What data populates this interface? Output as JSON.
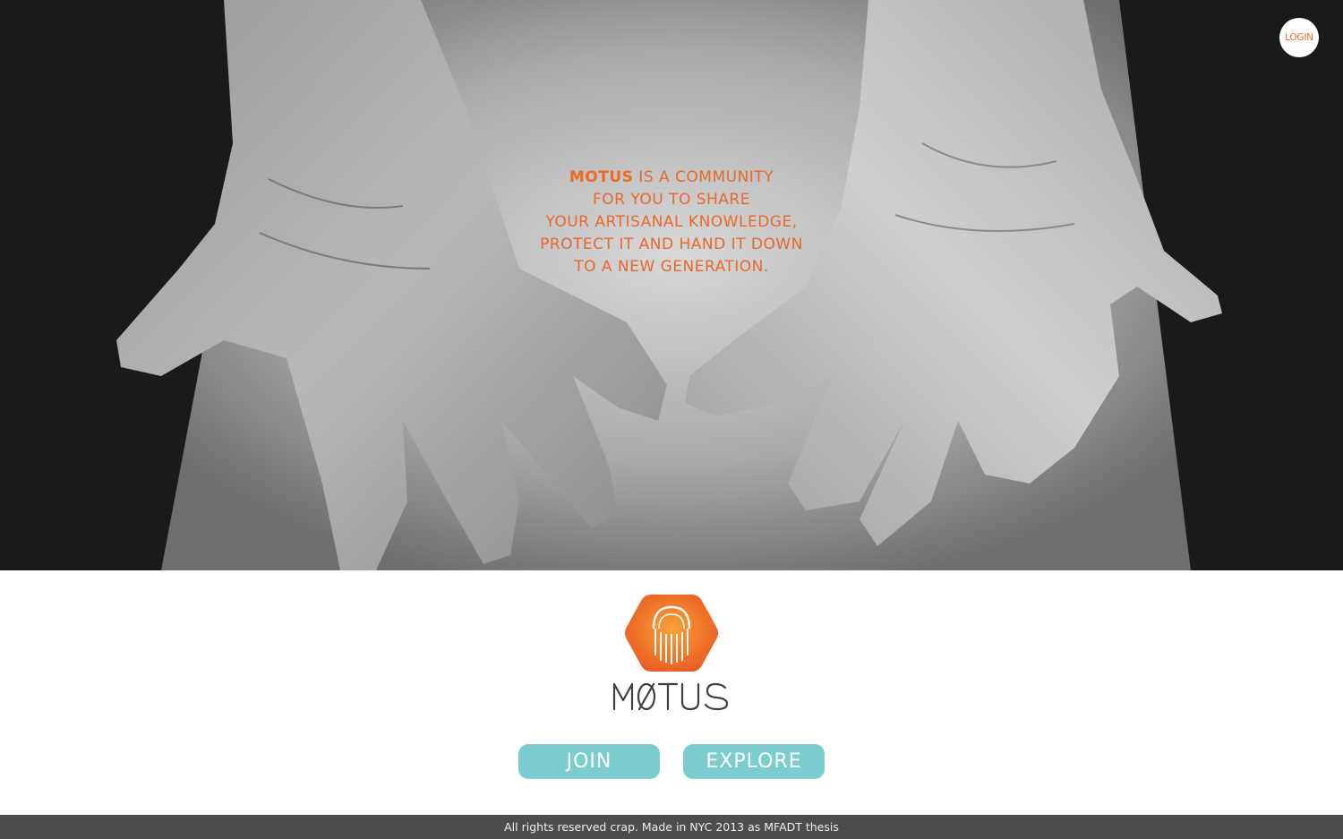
{
  "hero": {
    "tagline_brand": "MOTUS",
    "tagline_line1_rest": " IS A COMMUNITY",
    "tagline_line2": "FOR YOU TO SHARE",
    "tagline_line3": "YOUR ARTISANAL KNOWLEDGE,",
    "tagline_line4": "PROTECT IT AND HAND IT DOWN",
    "tagline_line5": "TO A NEW GENERATION."
  },
  "header": {
    "login_label": "LOGIN"
  },
  "logo": {
    "wordmark": "MOTUS",
    "icon": "motus-hexagon-jellyfish-icon"
  },
  "actions": {
    "join_label": "JOIN",
    "explore_label": "EXPLORE"
  },
  "footer": {
    "text": "All rights reserved crap. Made in NYC 2013 as MFADT thesis"
  },
  "colors": {
    "accent_orange": "#ee6a26",
    "button_teal": "#7ccdd0",
    "footer_bg": "#4d4d4f"
  }
}
